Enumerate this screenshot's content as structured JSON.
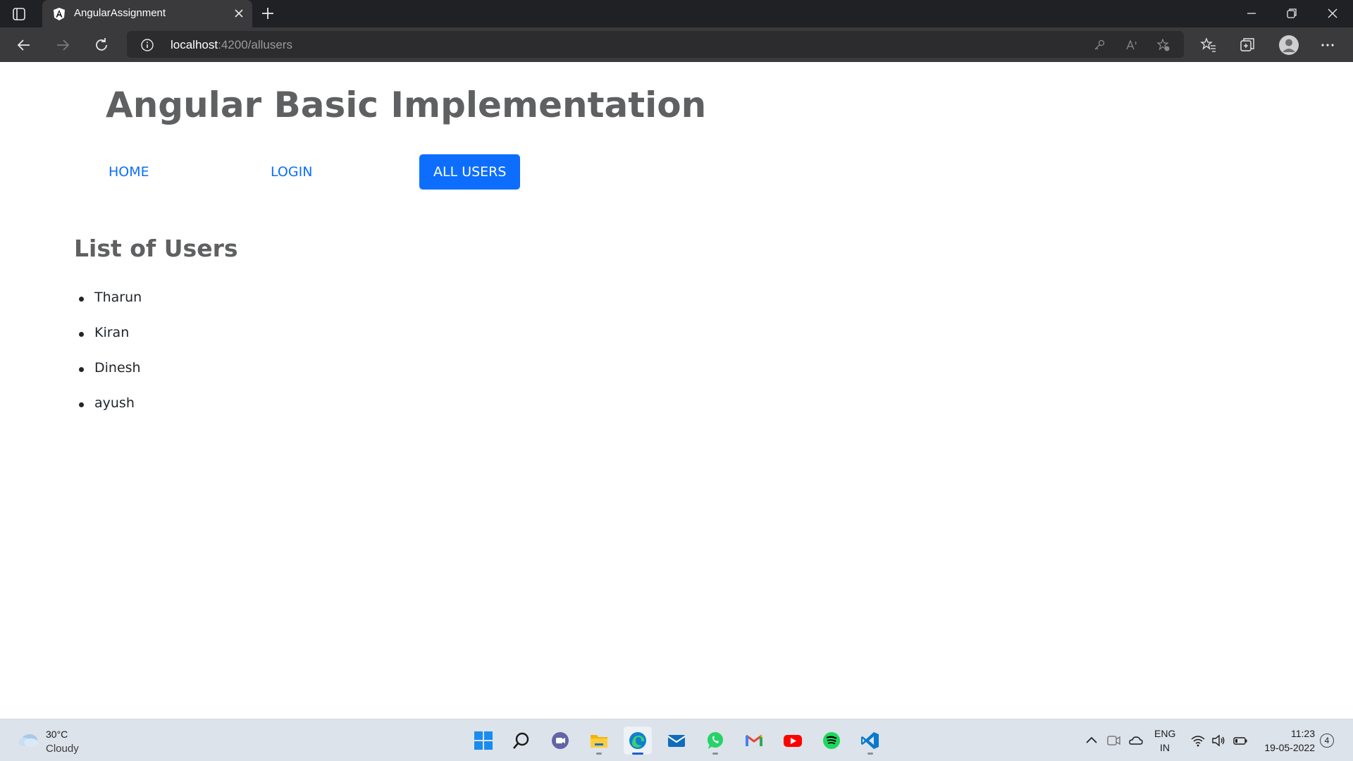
{
  "browser": {
    "tab_title": "AngularAssignment",
    "url_host": "localhost",
    "url_path": ":4200/allusers"
  },
  "page": {
    "title": "Angular Basic Implementation",
    "nav": [
      {
        "label": "HOME",
        "active": false
      },
      {
        "label": "LOGIN",
        "active": false
      },
      {
        "label": "ALL USERS",
        "active": true
      }
    ],
    "section_title": "List of Users",
    "users": [
      "Tharun",
      "Kiran",
      "Dinesh",
      "ayush"
    ]
  },
  "taskbar": {
    "weather_temp": "30°C",
    "weather_desc": "Cloudy",
    "lang_line1": "ENG",
    "lang_line2": "IN",
    "time": "11:23",
    "date": "19-05-2022",
    "notifications": "4",
    "apps": [
      "start-icon",
      "search-icon",
      "teams-chat-icon",
      "file-explorer-icon",
      "edge-icon",
      "mail-icon",
      "whatsapp-icon",
      "gmail-icon",
      "youtube-icon",
      "spotify-icon",
      "vscode-icon"
    ]
  },
  "colors": {
    "accent": "#0d6efd",
    "heading": "#5f6061",
    "tab_strip": "#202124",
    "toolbar": "#3a3a3c",
    "taskbar": "#dde3ea"
  }
}
